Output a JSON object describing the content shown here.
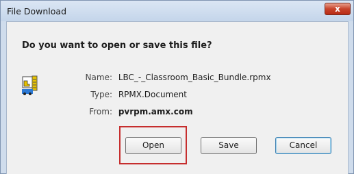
{
  "window": {
    "title": "File Download",
    "close_label": "x"
  },
  "dialog": {
    "question": "Do you want to open or save this file?",
    "icon": "rpmx-file-icon",
    "fields": [
      {
        "label": "Name:",
        "value": "LBC_-_Classroom_Basic_Bundle.rpmx"
      },
      {
        "label": "Type:",
        "value": "RPMX.Document"
      },
      {
        "label": "From:",
        "value": "pvrpm.amx.com"
      }
    ]
  },
  "buttons": {
    "open": "Open",
    "save": "Save",
    "cancel": "Cancel"
  },
  "colors": {
    "highlight": "#c62e2e",
    "title_bar": "#c4d5ea",
    "close": "#c8432b"
  }
}
